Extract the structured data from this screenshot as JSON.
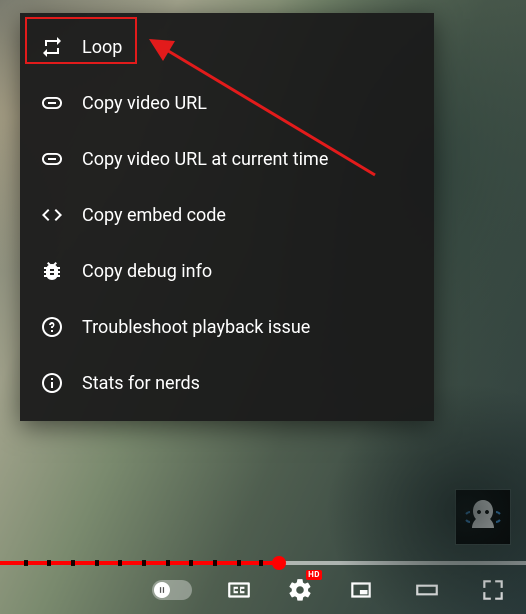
{
  "context_menu": {
    "items": [
      {
        "icon": "loop-icon",
        "label": "Loop"
      },
      {
        "icon": "link-icon",
        "label": "Copy video URL"
      },
      {
        "icon": "link-icon",
        "label": "Copy video URL at current time"
      },
      {
        "icon": "embed-icon",
        "label": "Copy embed code"
      },
      {
        "icon": "bug-icon",
        "label": "Copy debug info"
      },
      {
        "icon": "help-icon",
        "label": "Troubleshoot playback issue"
      },
      {
        "icon": "info-icon",
        "label": "Stats for nerds"
      }
    ]
  },
  "annotation": {
    "highlight_item_index": 0,
    "highlight_color": "#e21b1b"
  },
  "player": {
    "progress": {
      "played_pct": 53,
      "loaded_pct": 100,
      "segment_gaps_pct": [
        4.5,
        9,
        13.5,
        18,
        22.5,
        27,
        31.5,
        36,
        40.5,
        45,
        49.3
      ]
    },
    "hd_badge": "HD"
  }
}
